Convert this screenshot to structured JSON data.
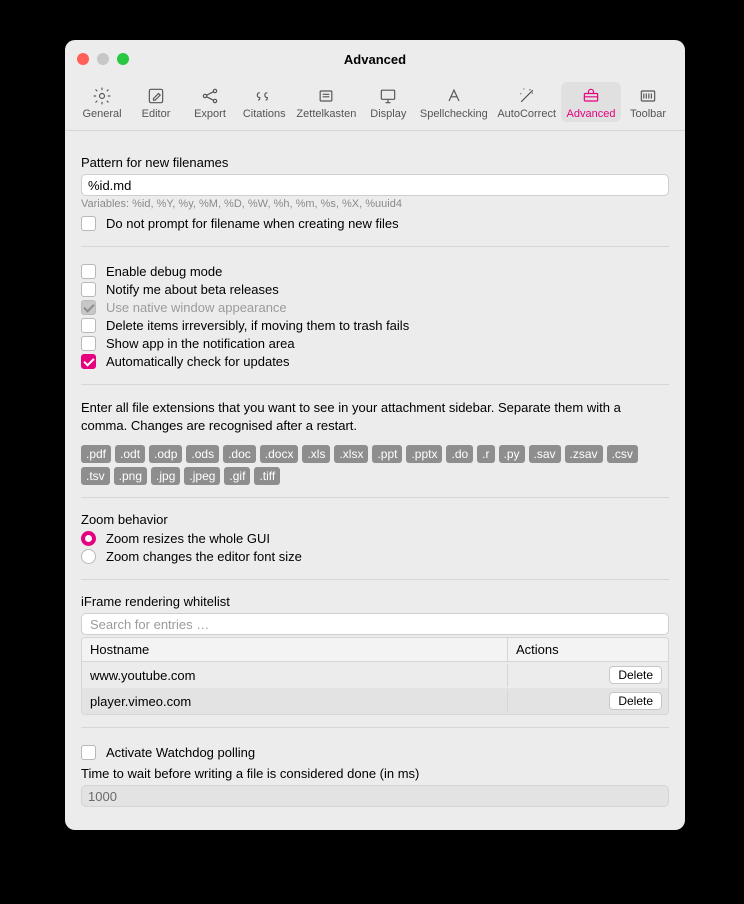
{
  "window": {
    "title": "Advanced"
  },
  "toolbar": {
    "items": [
      {
        "label": "General"
      },
      {
        "label": "Editor"
      },
      {
        "label": "Export"
      },
      {
        "label": "Citations"
      },
      {
        "label": "Zettelkasten"
      },
      {
        "label": "Display"
      },
      {
        "label": "Spellchecking"
      },
      {
        "label": "AutoCorrect"
      },
      {
        "label": "Advanced"
      },
      {
        "label": "Toolbar"
      }
    ]
  },
  "filenames": {
    "label": "Pattern for new filenames",
    "value": "%id.md",
    "hint": "Variables: %id, %Y, %y, %M, %D, %W, %h, %m, %s, %X, %uuid4",
    "noPrompt": "Do not prompt for filename when creating new files"
  },
  "options": {
    "debug": "Enable debug mode",
    "beta": "Notify me about beta releases",
    "nativeWindow": "Use native window appearance",
    "deleteIrreversibly": "Delete items irreversibly, if moving them to trash fails",
    "notificationArea": "Show app in the notification area",
    "autoUpdate": "Automatically check for updates"
  },
  "extensions": {
    "desc": "Enter all file extensions that you want to see in your attachment sidebar. Separate them with a comma. Changes are recognised after a restart.",
    "chips": [
      ".pdf",
      ".odt",
      ".odp",
      ".ods",
      ".doc",
      ".docx",
      ".xls",
      ".xlsx",
      ".ppt",
      ".pptx",
      ".do",
      ".r",
      ".py",
      ".sav",
      ".zsav",
      ".csv",
      ".tsv",
      ".png",
      ".jpg",
      ".jpeg",
      ".gif",
      ".tiff"
    ]
  },
  "zoom": {
    "label": "Zoom behavior",
    "opt1": "Zoom resizes the whole GUI",
    "opt2": "Zoom changes the editor font size"
  },
  "iframe": {
    "label": "iFrame rendering whitelist",
    "placeholder": "Search for entries …",
    "cols": {
      "host": "Hostname",
      "actions": "Actions"
    },
    "rows": [
      {
        "host": "www.youtube.com",
        "action": "Delete"
      },
      {
        "host": "player.vimeo.com",
        "action": "Delete"
      }
    ]
  },
  "watchdog": {
    "activate": "Activate Watchdog polling",
    "timeLabel": "Time to wait before writing a file is considered done (in ms)",
    "timeValue": "1000"
  }
}
